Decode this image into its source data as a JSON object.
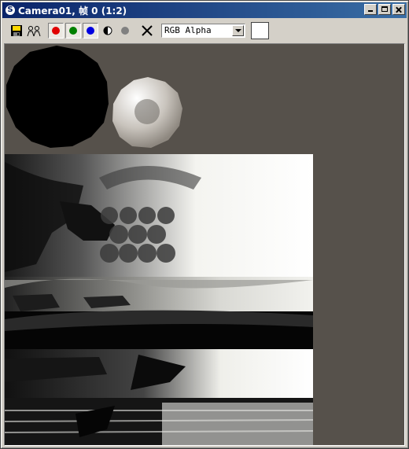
{
  "window": {
    "title": "Camera01, 帧 0 (1:2)"
  },
  "titlebar_buttons": [
    "minimize",
    "maximize",
    "close"
  ],
  "toolbar": {
    "tools": [
      {
        "name": "save-icon"
      },
      {
        "name": "clone-window-icon"
      },
      {
        "name": "red-channel-toggle",
        "color": "#e00000",
        "pressed": true
      },
      {
        "name": "green-channel-toggle",
        "color": "#008000",
        "pressed": true
      },
      {
        "name": "blue-channel-toggle",
        "color": "#0000e0",
        "pressed": true
      },
      {
        "name": "monochrome-toggle"
      },
      {
        "name": "alpha-channel-toggle",
        "color": "#808080"
      },
      {
        "name": "clear-icon"
      }
    ],
    "channel_select": "RGB Alpha",
    "swatch_color": "#ffffff"
  },
  "colors": {
    "titlebar_start": "#0a246a",
    "titlebar_end": "#3a6ea5",
    "viewport_bg": "#56514b"
  }
}
